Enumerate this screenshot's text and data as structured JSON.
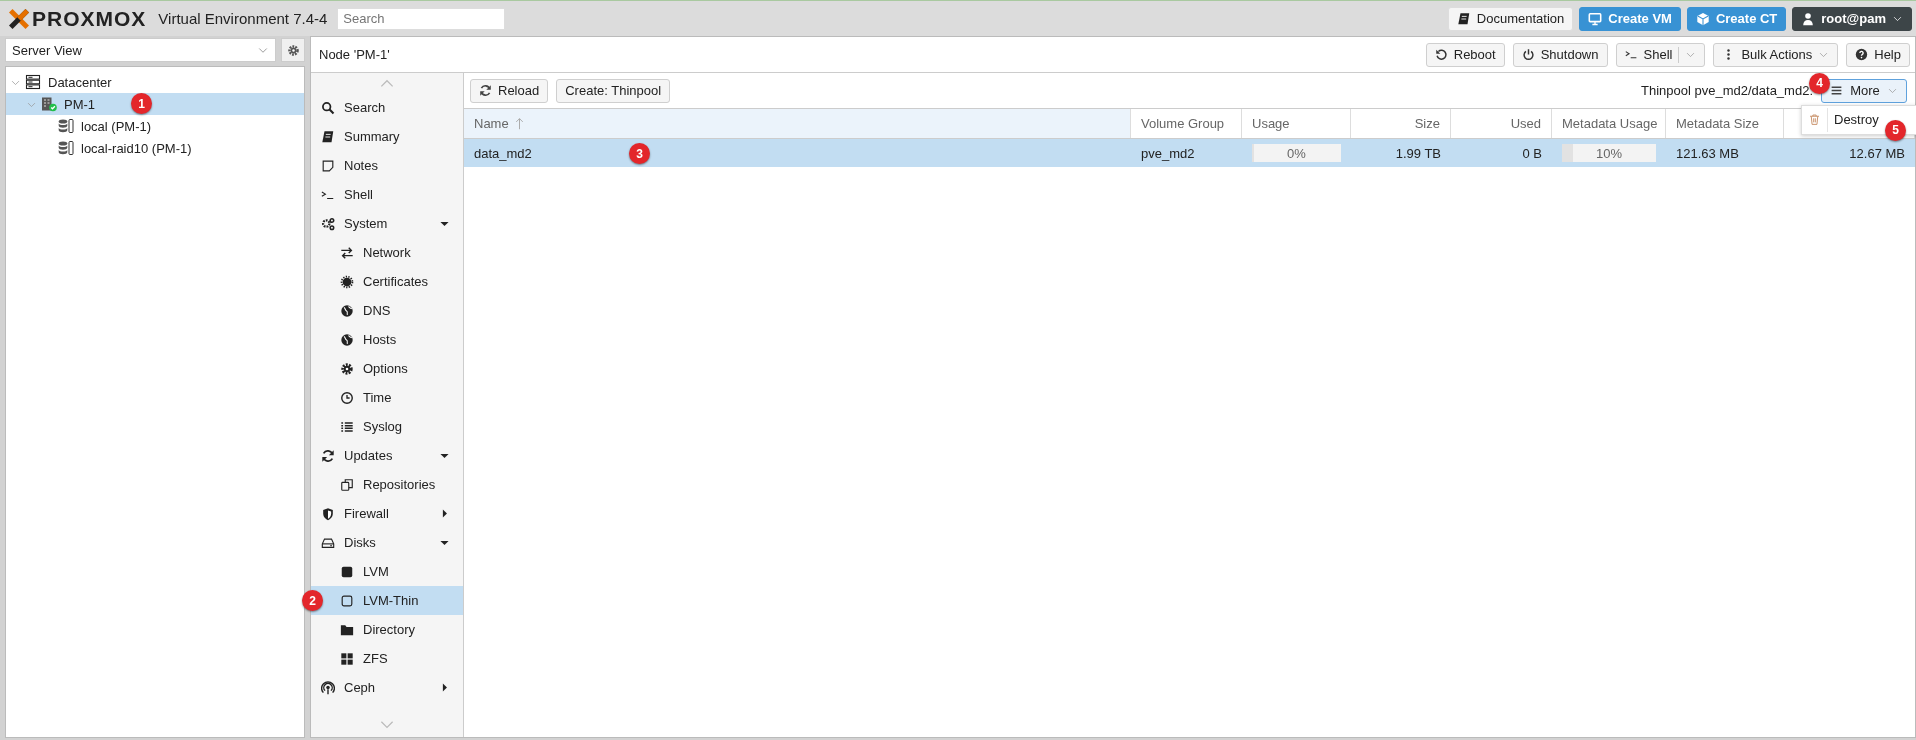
{
  "header": {
    "logo": "PROXMOX",
    "product": "Virtual Environment 7.4-4",
    "search": {
      "placeholder": "Search"
    },
    "buttons": [
      {
        "label": "Documentation",
        "kind": "plain"
      },
      {
        "label": "Create VM",
        "kind": "primary"
      },
      {
        "label": "Create CT",
        "kind": "primary"
      },
      {
        "label": "root@pam",
        "kind": "user"
      }
    ]
  },
  "resource_tree": {
    "view_select": {
      "value": "Server View"
    },
    "items": [
      {
        "label": "Datacenter",
        "kind": "datacenter",
        "expanded": true,
        "selected": false,
        "children": [
          {
            "label": "PM-1",
            "kind": "node",
            "expanded": true,
            "selected": true,
            "badge": "1",
            "children": [
              {
                "label": "local (PM-1)",
                "kind": "storage",
                "selected": false
              },
              {
                "label": "local-raid10 (PM-1)",
                "kind": "storage",
                "selected": false
              }
            ]
          }
        ]
      }
    ]
  },
  "node_panel": {
    "title": "Node 'PM-1'",
    "buttons": [
      {
        "label": "Reboot",
        "kind": "plain"
      },
      {
        "label": "Shutdown",
        "kind": "plain"
      },
      {
        "label": "Shell",
        "kind": "split"
      },
      {
        "label": "Bulk Actions",
        "kind": "dropdown"
      },
      {
        "label": "Help",
        "kind": "plain"
      }
    ]
  },
  "nav_menu": {
    "items": [
      {
        "label": "Search",
        "selected": false
      },
      {
        "label": "Summary",
        "selected": false
      },
      {
        "label": "Notes",
        "selected": false
      },
      {
        "label": "Shell",
        "selected": false
      },
      {
        "label": "System",
        "selected": false,
        "expanded": true,
        "children": [
          {
            "label": "Network",
            "selected": false
          },
          {
            "label": "Certificates",
            "selected": false
          },
          {
            "label": "DNS",
            "selected": false
          },
          {
            "label": "Hosts",
            "selected": false
          },
          {
            "label": "Options",
            "selected": false
          },
          {
            "label": "Time",
            "selected": false
          },
          {
            "label": "Syslog",
            "selected": false
          }
        ]
      },
      {
        "label": "Updates",
        "selected": false,
        "expanded": true,
        "children": [
          {
            "label": "Repositories",
            "selected": false
          }
        ]
      },
      {
        "label": "Firewall",
        "selected": false,
        "expanded": false
      },
      {
        "label": "Disks",
        "selected": false,
        "expanded": true,
        "children": [
          {
            "label": "LVM",
            "selected": false
          },
          {
            "label": "LVM-Thin",
            "selected": true,
            "badge": "2"
          },
          {
            "label": "Directory",
            "selected": false
          },
          {
            "label": "ZFS",
            "selected": false
          }
        ]
      },
      {
        "label": "Ceph",
        "selected": false,
        "expanded": false
      }
    ]
  },
  "lvm_thin": {
    "toolbar": {
      "buttons": [
        {
          "label": "Reload"
        },
        {
          "label": "Create: Thinpool"
        }
      ],
      "status": "Thinpool pve_md2/data_md2:",
      "more": {
        "label": "More",
        "expanded": true,
        "badge": "4",
        "menu": [
          {
            "label": "Destroy",
            "badge": "5"
          }
        ]
      }
    },
    "columns": [
      {
        "label": "Name",
        "sorted": true
      },
      {
        "label": "Volume Group",
        "sorted": false
      },
      {
        "label": "Usage",
        "sorted": false
      },
      {
        "label": "Size",
        "sorted": false
      },
      {
        "label": "Used",
        "sorted": false
      },
      {
        "label": "Metadata Usage",
        "sorted": false
      },
      {
        "label": "Metadata Size",
        "sorted": false
      },
      {
        "sorted": false
      }
    ],
    "rows": [
      {
        "selected": true,
        "badge": "3",
        "cells": [
          {
            "text": "data_md2"
          },
          {
            "text": "pve_md2"
          },
          {
            "text": "0%",
            "level": 0
          },
          {
            "text": "1.99 TB"
          },
          {
            "text": "0 B"
          },
          {
            "text": "10%",
            "level": 0.1
          },
          {
            "text": "121.63 MB"
          },
          {
            "text": "12.67 MB"
          }
        ]
      }
    ]
  }
}
